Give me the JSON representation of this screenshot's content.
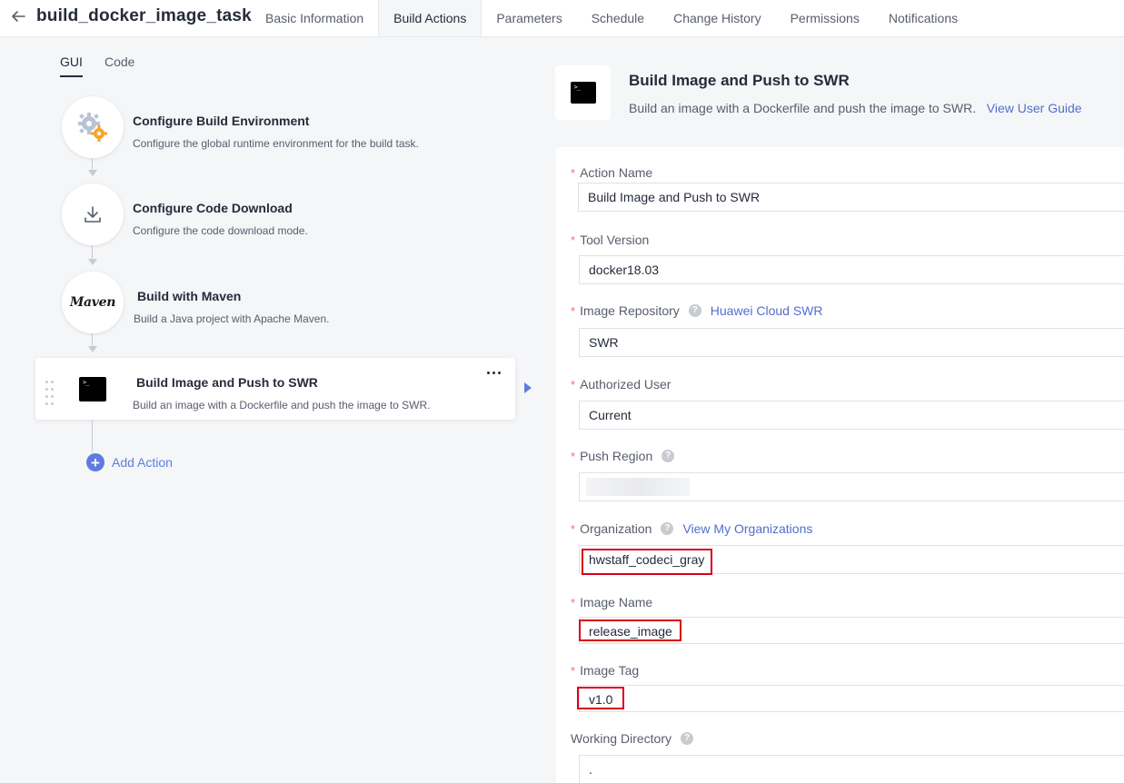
{
  "header": {
    "title": "build_docker_image_task",
    "tabs": [
      {
        "label": "Basic Information",
        "active": false
      },
      {
        "label": "Build Actions",
        "active": true
      },
      {
        "label": "Parameters",
        "active": false
      },
      {
        "label": "Schedule",
        "active": false
      },
      {
        "label": "Change History",
        "active": false
      },
      {
        "label": "Permissions",
        "active": false
      },
      {
        "label": "Notifications",
        "active": false
      }
    ]
  },
  "editor_modes": {
    "gui": "GUI",
    "code": "Code",
    "active": "GUI"
  },
  "steps": [
    {
      "title": "Configure Build Environment",
      "desc": "Configure the global runtime environment for the build task.",
      "icon": "gears-icon"
    },
    {
      "title": "Configure Code Download",
      "desc": "Configure the code download mode.",
      "icon": "download-icon"
    },
    {
      "title": "Build with Maven",
      "desc": "Build a Java project with Apache Maven.",
      "icon": "maven-logo",
      "logo_text": "Maven"
    },
    {
      "title": "Build Image and Push to SWR",
      "desc": "Build an image with a Dockerfile and push the image to SWR.",
      "icon": "terminal-icon",
      "selected": true
    }
  ],
  "add_action": {
    "label": "Add Action"
  },
  "detail": {
    "title": "Build Image and Push to SWR",
    "desc": "Build an image with a Dockerfile and push the image to SWR.",
    "guide_link": "View User Guide"
  },
  "form": {
    "action_name": {
      "label": "Action Name",
      "value": "Build Image and Push to SWR",
      "required": true
    },
    "tool_version": {
      "label": "Tool Version",
      "value": "docker18.03",
      "required": true
    },
    "image_repository": {
      "label": "Image Repository",
      "link": "Huawei Cloud SWR",
      "value": "SWR",
      "required": true
    },
    "authorized_user": {
      "label": "Authorized User",
      "value": "Current",
      "required": true
    },
    "push_region": {
      "label": "Push Region",
      "value": "",
      "required": true
    },
    "organization": {
      "label": "Organization",
      "link": "View My Organizations",
      "value": "hwstaff_codeci_gray",
      "required": true
    },
    "image_name": {
      "label": "Image Name",
      "value": "release_image",
      "required": true
    },
    "image_tag": {
      "label": "Image Tag",
      "value": "v1.0",
      "required": true
    },
    "working_directory": {
      "label": "Working Directory",
      "value": ".",
      "required": false
    }
  },
  "colors": {
    "accent": "#5e7ce0",
    "link": "#526ecc",
    "required": "#f66f6a",
    "highlight": "#d9001b",
    "panel_bg": "#f5f6f8"
  }
}
